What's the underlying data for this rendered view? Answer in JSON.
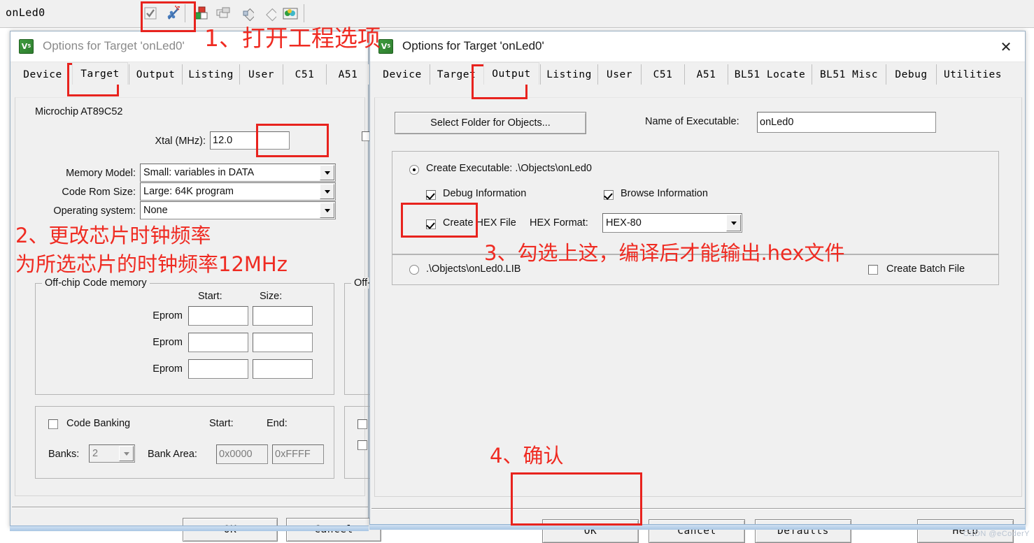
{
  "ide": {
    "project_name": "onLed0",
    "toolbar_icons": [
      "translate-check-icon",
      "target-options-magic-wand-icon",
      "build-target-icon",
      "rebuild-all-icon",
      "batch-build-icon",
      "stop-build-icon",
      "manage-project-items-icon"
    ]
  },
  "watermark": "CSDN @eCoderY",
  "left_dialog": {
    "title": "Options for Target 'onLed0'",
    "icon": "keil-target-options-icon",
    "tabs": [
      "Device",
      "Target",
      "Output",
      "Listing",
      "User",
      "C51",
      "A51"
    ],
    "active_tab": "Target",
    "device_name": "Microchip AT89C52",
    "fields": {
      "xtal_label": "Xtal (MHz):",
      "xtal_value": "12.0",
      "memory_model_label": "Memory Model:",
      "memory_model_value": "Small: variables in DATA",
      "code_rom_size_label": "Code Rom Size:",
      "code_rom_size_value": "Large: 64K program",
      "operating_system_label": "Operating system:",
      "operating_system_value": "None"
    },
    "offchip_code_memory": {
      "title": "Off-chip Code memory",
      "col_start": "Start:",
      "col_size": "Size:",
      "rows": [
        "Eprom",
        "Eprom",
        "Eprom"
      ],
      "values": [
        {
          "start": "",
          "size": ""
        },
        {
          "start": "",
          "size": ""
        },
        {
          "start": "",
          "size": ""
        }
      ]
    },
    "offchip_xdata_memory": {
      "title": "Off-"
    },
    "code_banking": {
      "checkbox_label": "Code Banking",
      "checked": false,
      "col_start": "Start:",
      "col_end": "End:",
      "banks_label": "Banks:",
      "banks_value": "2",
      "bank_area_label": "Bank Area:",
      "bank_start": "0x0000",
      "bank_end": "0xFFFF"
    },
    "buttons": {
      "ok": "OK",
      "cancel": "Cancel"
    }
  },
  "right_dialog": {
    "title": "Options for Target 'onLed0'",
    "icon": "keil-target-options-icon",
    "close_icon": "close-icon",
    "tabs": [
      "Device",
      "Target",
      "Output",
      "Listing",
      "User",
      "C51",
      "A51",
      "BL51 Locate",
      "BL51 Misc",
      "Debug",
      "Utilities"
    ],
    "active_tab": "Output",
    "select_folder_button": "Select Folder for Objects...",
    "name_of_executable_label": "Name of Executable:",
    "name_of_executable_value": "onLed0",
    "create_executable": {
      "label": "Create Executable:  .\\Objects\\onLed0",
      "selected": true
    },
    "debug_information": {
      "label": "Debug Information",
      "checked": true
    },
    "browse_information": {
      "label": "Browse Information",
      "checked": true
    },
    "create_hex_file": {
      "label": "Create HEX File",
      "checked": true
    },
    "hex_format_label": "HEX Format:",
    "hex_format_value": "HEX-80",
    "create_library": {
      "label": ".\\Objects\\onLed0.LIB",
      "selected": false
    },
    "create_batch_file": {
      "label": "Create Batch File",
      "checked": false
    },
    "buttons": {
      "ok": "OK",
      "cancel": "Cancel",
      "defaults": "Defaults",
      "help": "Help"
    }
  },
  "annotations": {
    "step1": "1、打开工程选项",
    "step2_line1": "2、更改芯片时钟频率",
    "step2_line2": "为所选芯片的时钟频率12MHz",
    "step3": "3、勾选上这，编译后才能输出.hex文件",
    "step4": "4、确认"
  },
  "colors": {
    "annotation_red": "#ef2b22",
    "highlight_box": "#e8231e",
    "dialog_face": "#f0f0f0",
    "window_border": "#9ab0c4"
  }
}
